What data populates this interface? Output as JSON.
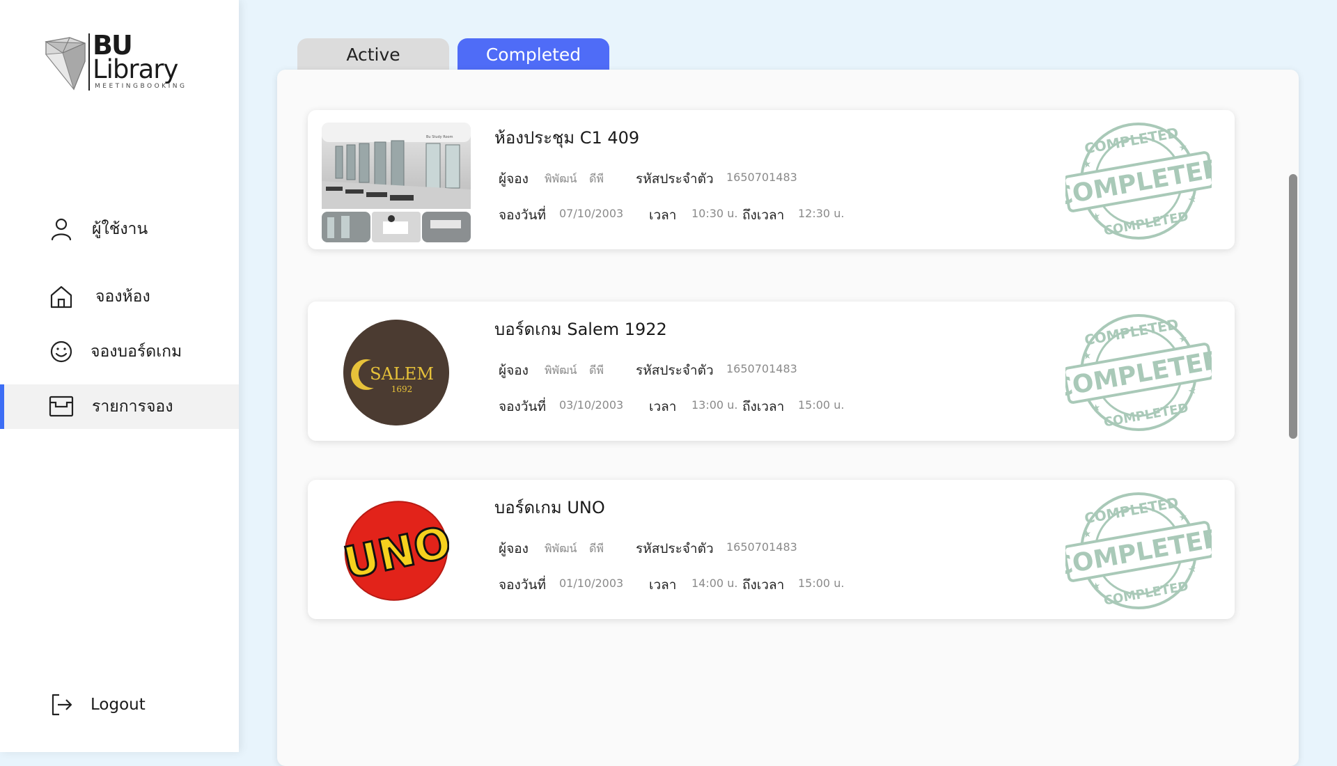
{
  "brand": {
    "line1": "BU",
    "line2": "Library",
    "tagline": "MEETINGBOOKING"
  },
  "sidebar": {
    "items": [
      {
        "label": "ผู้ใช้งาน",
        "icon": "user-icon"
      },
      {
        "label": "จองห้อง",
        "icon": "home-icon"
      },
      {
        "label": "จองบอร์ดเกม",
        "icon": "smile-icon"
      },
      {
        "label": "รายการจอง",
        "icon": "booking-list-icon",
        "active": true
      }
    ],
    "logout": "Logout"
  },
  "tabs": {
    "active": "Active",
    "completed": "Completed",
    "selected": "Completed"
  },
  "labels": {
    "booker": "ผู้จอง",
    "student_id": "รหัสประจำตัว",
    "date": "จองวันที่",
    "time": "เวลา",
    "to_time": "ถึงเวลา",
    "stamp_text": "COMPLETED"
  },
  "bookings": [
    {
      "title_prefix": "ห้องประชุม",
      "title": "C1 409",
      "booker_first": "พิพัฒน์",
      "booker_last": "ดีพี",
      "student_id": "1650701483",
      "date": "07/10/2003",
      "time": "10:30 u.",
      "to_time": "12:30 u.",
      "image": "meeting-room-photo"
    },
    {
      "title_prefix": "บอร์ดเกม",
      "title": "Salem 1922",
      "booker_first": "พิพัฒน์",
      "booker_last": "ดีพี",
      "student_id": "1650701483",
      "date": "03/10/2003",
      "time": "13:00 u.",
      "to_time": "15:00 u.",
      "image": "salem-game-logo",
      "image_text": "SALEM",
      "image_subtext": "1692"
    },
    {
      "title_prefix": "บอร์ดเกม",
      "title": "UNO",
      "booker_first": "พิพัฒน์",
      "booker_last": "ดีพี",
      "student_id": "1650701483",
      "date": "01/10/2003",
      "time": "14:00 u.",
      "to_time": "15:00 u.",
      "image": "uno-game-logo",
      "image_text": "UNO"
    }
  ],
  "colors": {
    "accent": "#4f6cf7",
    "active_indicator": "#3d6ef5",
    "stamp": "#a9c9b8",
    "background": "#e8f4fc"
  }
}
